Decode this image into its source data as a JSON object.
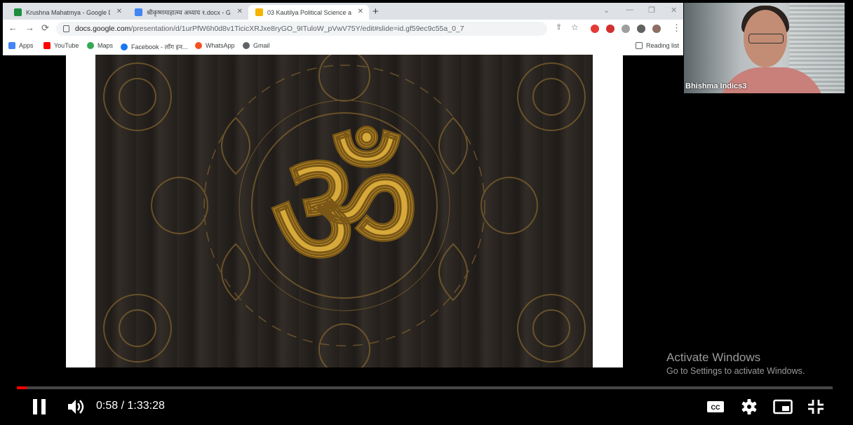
{
  "browser": {
    "tabs": [
      {
        "title": "Krushna Mahatmya - Google Dri",
        "favicon_color": "#1e8e3e"
      },
      {
        "title": "श्रीकृष्णमाहात्म्य अध्याय १.docx - Go",
        "favicon_color": "#4285f4"
      },
      {
        "title": "03 Kautilya Political Science and",
        "favicon_color": "#f4b400"
      }
    ],
    "new_tab": "+",
    "url_host": "docs.google.com",
    "url_path": "/presentation/d/1urPfW6h0d8v1TicicXRJxe8ryGO_9ITuloW_pVwV75Y/edit#slide=id.gf59ec9c55a_0_7",
    "bookmarks": [
      {
        "label": "Apps",
        "color": "#4285f4"
      },
      {
        "label": "YouTube",
        "color": "#ff0000"
      },
      {
        "label": "Maps",
        "color": "#34a853"
      },
      {
        "label": "Facebook - लॉग इन...",
        "color": "#1877f2"
      },
      {
        "label": "WhatsApp",
        "color": "#f4511e"
      },
      {
        "label": "Gmail",
        "color": "#5f6368"
      }
    ],
    "reading_list": "Reading list"
  },
  "slide": {
    "symbol": "ॐ",
    "symbol_color": "#d6a93a"
  },
  "webcam": {
    "participant": "Bhishma Indics3"
  },
  "watermark": {
    "title": "Activate Windows",
    "subtitle": "Go to Settings to activate Windows."
  },
  "player": {
    "time_display": "0:58 / 1:33:28",
    "current_time": "0:58",
    "duration": "1:33:28",
    "progress_fraction": 0.0103,
    "accent_color": "#ff0000",
    "icons": [
      "pause-icon",
      "volume-icon",
      "cc-icon",
      "settings-icon",
      "miniplayer-icon",
      "exit-fullscreen-icon"
    ]
  }
}
